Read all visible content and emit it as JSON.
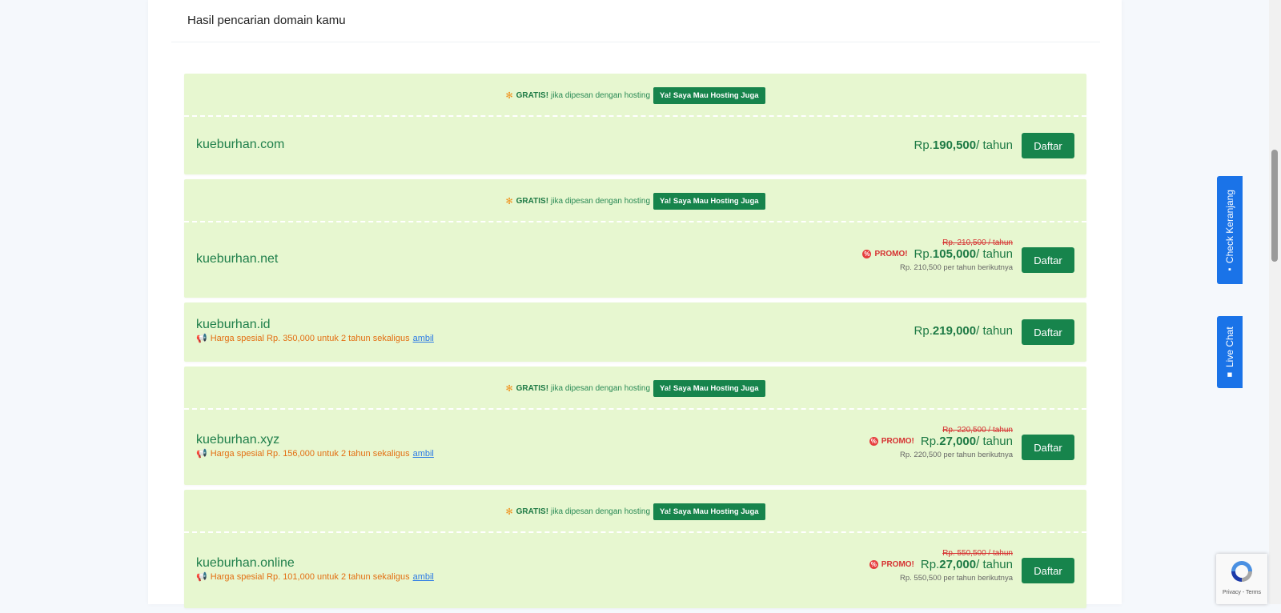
{
  "page": {
    "title": "Hasil pencarian domain kamu"
  },
  "results": [
    {
      "promo": {
        "gratis": "GRATIS!",
        "text": "jika dipesan dengan hosting",
        "button": "Ya! Saya Mau Hosting Juga"
      },
      "domain": "kueburhan.com",
      "special": null,
      "old_price": null,
      "promo_label": null,
      "currency": "Rp.",
      "price": "190,500",
      "per": "/ tahun",
      "next_year": null,
      "register": "Daftar"
    },
    {
      "promo": {
        "gratis": "GRATIS!",
        "text": "jika dipesan dengan hosting",
        "button": "Ya! Saya Mau Hosting Juga"
      },
      "domain": "kueburhan.net",
      "special": null,
      "old_price": "Rp. 210,500 / tahun",
      "promo_label": "PROMO!",
      "currency": "Rp.",
      "price": "105,000",
      "per": "/ tahun",
      "next_year": "Rp. 210,500 per tahun berikutnya",
      "register": "Daftar"
    },
    {
      "promo": null,
      "domain": "kueburhan.id",
      "special": {
        "text": "Harga spesial Rp. 350,000 untuk 2 tahun sekaligus",
        "link": "ambil"
      },
      "old_price": null,
      "promo_label": null,
      "currency": "Rp.",
      "price": "219,000",
      "per": "/ tahun",
      "next_year": null,
      "register": "Daftar"
    },
    {
      "promo": {
        "gratis": "GRATIS!",
        "text": "jika dipesan dengan hosting",
        "button": "Ya! Saya Mau Hosting Juga"
      },
      "domain": "kueburhan.xyz",
      "special": {
        "text": "Harga spesial Rp. 156,000 untuk 2 tahun sekaligus",
        "link": "ambil"
      },
      "old_price": "Rp. 220,500 / tahun",
      "promo_label": "PROMO!",
      "currency": "Rp.",
      "price": "27,000",
      "per": "/ tahun",
      "next_year": "Rp. 220,500 per tahun berikutnya",
      "register": "Daftar"
    },
    {
      "promo": {
        "gratis": "GRATIS!",
        "text": "jika dipesan dengan hosting",
        "button": "Ya! Saya Mau Hosting Juga"
      },
      "domain": "kueburhan.online",
      "special": {
        "text": "Harga spesial Rp. 101,000 untuk 2 tahun sekaligus",
        "link": "ambil"
      },
      "old_price": "Rp. 550,500 / tahun",
      "promo_label": "PROMO!",
      "currency": "Rp.",
      "price": "27,000",
      "per": "/ tahun",
      "next_year": "Rp. 550,500 per tahun berikutnya",
      "register": "Daftar"
    }
  ],
  "side_tabs": {
    "cart": "Check Keranjang",
    "chat": "Live Chat"
  },
  "recaptcha": {
    "text": "Privacy - Terms"
  },
  "icons": {
    "gift": "gift-icon",
    "megaphone": "megaphone-icon",
    "promo": "promo-icon",
    "cart": "cart-icon",
    "chat": "chat-icon"
  },
  "colors": {
    "card_bg": "#e7f7d0",
    "primary_green": "#17844c",
    "domain_green": "#1f7f4b",
    "promo_red": "#d63232",
    "special_orange": "#e36f12",
    "tab_blue": "#1a73e8"
  }
}
